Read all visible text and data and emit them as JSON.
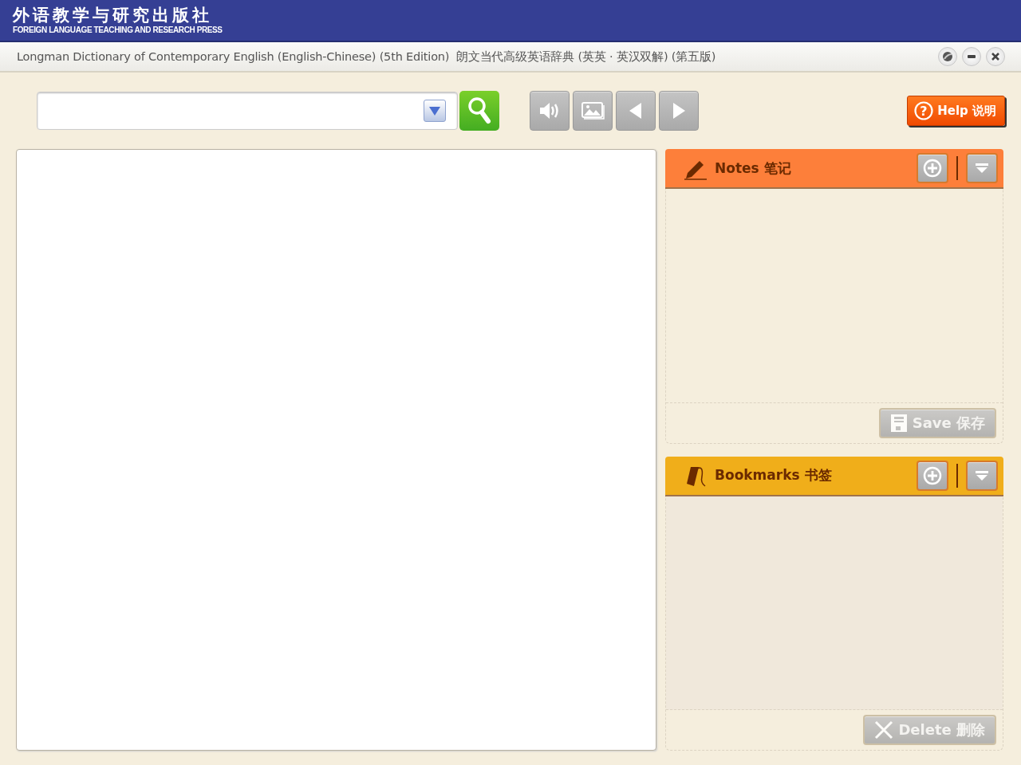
{
  "header": {
    "logo_cn": "外语教学与研究出版社",
    "logo_en": "FOREIGN LANGUAGE TEACHING AND RESEARCH PRESS"
  },
  "title_bar": {
    "title": "Longman Dictionary of Contemporary English (English-Chinese) (5th Edition)  朗文当代高级英语辞典 (英英 · 英汉双解) (第五版)"
  },
  "toolbar": [
    {
      "kind": "sound"
    },
    {
      "kind": "image"
    },
    {
      "kind": "back"
    },
    {
      "kind": "forward"
    }
  ],
  "help_button": {
    "icon": "?",
    "label": "Help 说明"
  },
  "panels": [
    {
      "kind": "notes",
      "title": "Notes 笔记",
      "color": "#fd7f3a",
      "action": {
        "kind": "save",
        "label": "Save 保存",
        "disabled": true
      }
    },
    {
      "kind": "bookmarks",
      "title": "Bookmarks 书签",
      "color": "#f0ae1a",
      "action": {
        "kind": "delete",
        "label": "Delete 删除",
        "disabled": true
      }
    }
  ]
}
